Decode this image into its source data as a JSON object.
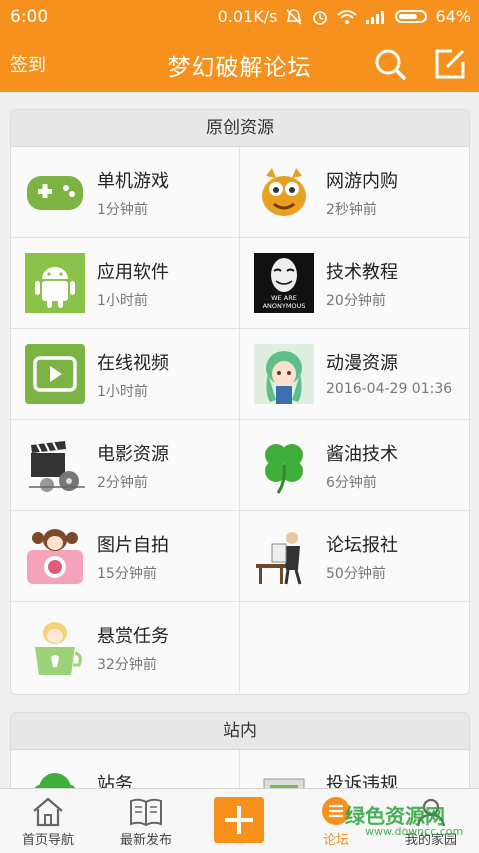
{
  "status": {
    "time": "6:00",
    "speed": "0.01K/s",
    "battery": "64%"
  },
  "header": {
    "signin": "签到",
    "title": "梦幻破解论坛"
  },
  "section1": {
    "title": "原创资源",
    "items": [
      {
        "name": "单机游戏",
        "time": "1分钟前",
        "icon": "gamepad-icon"
      },
      {
        "name": "网游内购",
        "time": "2秒钟前",
        "icon": "cartoon-monster-icon"
      },
      {
        "name": "应用软件",
        "time": "1小时前",
        "icon": "android-icon"
      },
      {
        "name": "技术教程",
        "time": "20分钟前",
        "icon": "anonymous-mask-icon",
        "icon_text": "WE ARE ANONYMOUS"
      },
      {
        "name": "在线视频",
        "time": "1小时前",
        "icon": "video-play-icon"
      },
      {
        "name": "动漫资源",
        "time": "2016-04-29 01:36",
        "icon": "anime-girl-icon"
      },
      {
        "name": "电影资源",
        "time": "2分钟前",
        "icon": "film-clapper-icon"
      },
      {
        "name": "酱油技术",
        "time": "6分钟前",
        "icon": "clover-icon"
      },
      {
        "name": "图片自拍",
        "time": "15分钟前",
        "icon": "camera-girl-icon"
      },
      {
        "name": "论坛报社",
        "time": "50分钟前",
        "icon": "newspaper-reader-icon"
      },
      {
        "name": "悬赏任务",
        "time": "32分钟前",
        "icon": "reward-cup-icon"
      }
    ]
  },
  "section2": {
    "title": "站内",
    "items": [
      {
        "name": "站务",
        "icon": "tree-icon"
      },
      {
        "name": "投诉违规",
        "icon": "document-icon"
      }
    ]
  },
  "tabs": [
    {
      "label": "首页导航",
      "icon": "home-icon"
    },
    {
      "label": "最新发布",
      "icon": "book-icon"
    },
    {
      "label": "",
      "icon": "plus-icon"
    },
    {
      "label": "论坛",
      "icon": "forum-list-icon"
    },
    {
      "label": "我的家园",
      "icon": "user-icon"
    }
  ],
  "watermark": {
    "text": "绿色资源网",
    "url": "www.downcc.com"
  },
  "colors": {
    "brand": "#f6911d",
    "active_tab": "#f6911d"
  }
}
